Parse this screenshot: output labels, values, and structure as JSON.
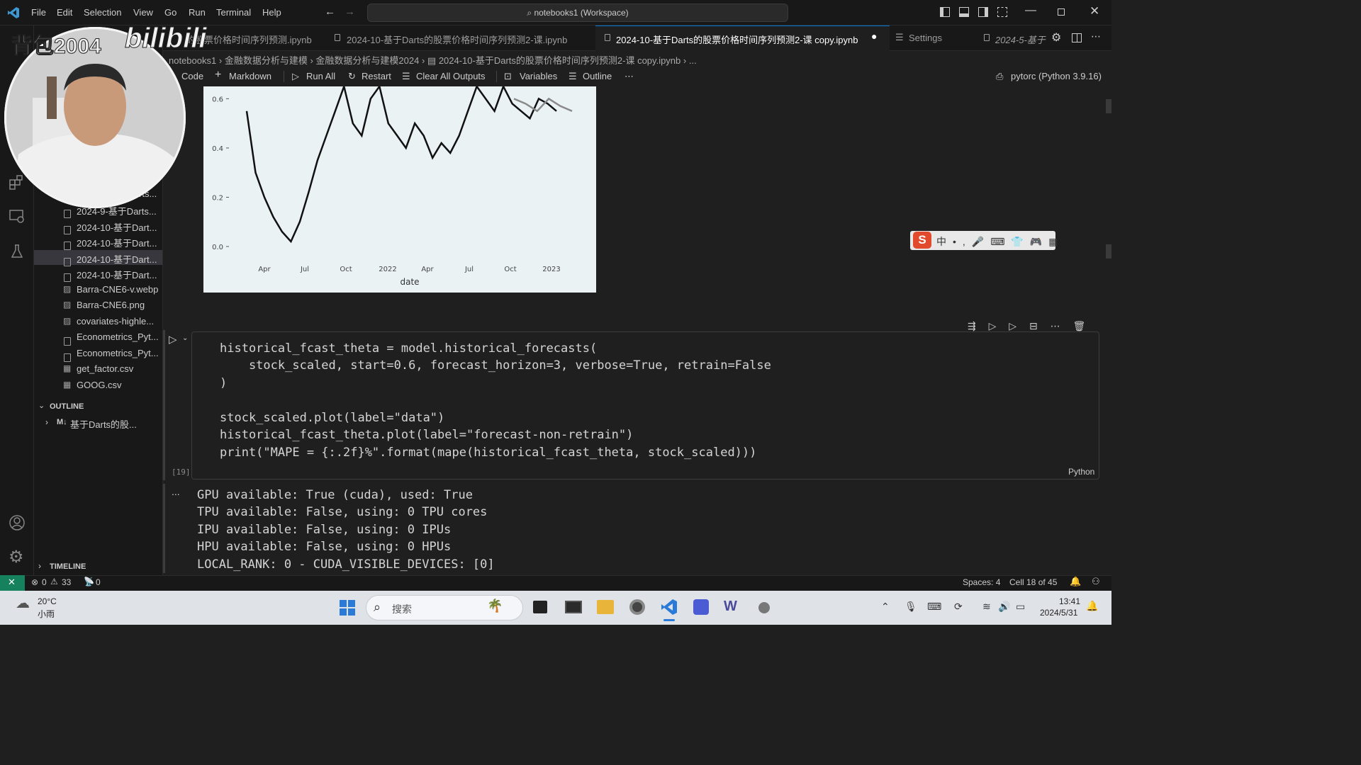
{
  "titlebar": {
    "menus": [
      "File",
      "Edit",
      "Selection",
      "View",
      "Go",
      "Run",
      "Terminal",
      "Help"
    ],
    "workspace": "notebooks1 (Workspace)"
  },
  "tabs": [
    {
      "label": "的股票价格时间序列预测.ipynb"
    },
    {
      "label": "2024-10-基于Darts的股票价格时间序列预测2-课.ipynb"
    },
    {
      "label": "2024-10-基于Darts的股票价格时间序列预测2-课 copy.ipynb"
    },
    {
      "label": "Settings"
    },
    {
      "label": "2024-5-基于"
    }
  ],
  "breadcrumb": [
    "notebooks1",
    "金融数据分析与建模",
    "金融数据分析与建模2024",
    "2024-10-基于Darts的股票价格时间序列预测2-课 copy.ipynb",
    "..."
  ],
  "toolbar": {
    "code": "Code",
    "markdown": "Markdown",
    "run_all": "Run All",
    "restart": "Restart",
    "clear": "Clear All Outputs",
    "variables": "Variables",
    "outline": "Outline",
    "kernel": "pytorc (Python 3.9.16)"
  },
  "sidebar": {
    "files": [
      "2024-9-基于Darts...",
      "2024-10-基于Dart...",
      "2024-10-基于Dart...",
      "2024-10-基于Dart...",
      "2024-10-基于Dart...",
      "Barra-CNE6-v.webp",
      "Barra-CNE6.png",
      "covariates-highle...",
      "Econometrics_Pyt...",
      "Econometrics_Pyt...",
      "get_factor.csv",
      "GOOG.csv"
    ],
    "partial_file": "rts...",
    "outline_title": "OUTLINE",
    "outline_item_tag": "M↓",
    "outline_item": "基于Darts的股...",
    "timeline_title": "TIMELINE"
  },
  "chart_data": {
    "type": "line",
    "xlabel": "date",
    "x_ticks": [
      "Apr",
      "Jul",
      "Oct",
      "2022",
      "Apr",
      "Jul",
      "Oct",
      "2023"
    ],
    "y_ticks": [
      "0.0",
      "0.2",
      "0.4",
      "0.6"
    ],
    "ylim": [
      0,
      0.65
    ],
    "grid": false,
    "series": [
      {
        "color": "#111111",
        "values": [
          0.55,
          0.3,
          0.2,
          0.12,
          0.06,
          0.02,
          0.1,
          0.22,
          0.35,
          0.45,
          0.55,
          0.65,
          0.5,
          0.45,
          0.6,
          0.65,
          0.5,
          0.45,
          0.4,
          0.5,
          0.45,
          0.36,
          0.42,
          0.38,
          0.45,
          0.55,
          0.65,
          0.6,
          0.55,
          0.65,
          0.58,
          0.55,
          0.52,
          0.6,
          0.58,
          0.55
        ]
      },
      {
        "color": "#8a8a8a",
        "values": [
          0.6,
          0.58,
          0.55,
          0.6,
          0.57,
          0.55
        ]
      }
    ]
  },
  "cell": {
    "execution_count": "[19]",
    "language": "Python",
    "code_lines": [
      "historical_fcast_theta = model.historical_forecasts(",
      "    stock_scaled, start=0.6, forecast_horizon=3, verbose=True, retrain=False",
      ")",
      "",
      "stock_scaled.plot(label=\"data\")",
      "historical_fcast_theta.plot(label=\"forecast-non-retrain\")",
      "print(\"MAPE = {:.2f}%\".format(mape(historical_fcast_theta, stock_scaled)))"
    ]
  },
  "output": [
    "GPU available: True (cuda), used: True",
    "TPU available: False, using: 0 TPU cores",
    "IPU available: False, using: 0 IPUs",
    "HPU available: False, using: 0 HPUs",
    "LOCAL_RANK: 0 - CUDA_VISIBLE_DEVICES: [0]"
  ],
  "output_more": "...",
  "statusbar": {
    "errors": "0",
    "warnings": "33",
    "ports": "0",
    "spaces": "Spaces: 4",
    "cell": "Cell 18 of 45"
  },
  "taskbar": {
    "temp": "20°C",
    "weather": "小雨",
    "search": "搜索",
    "time": "13:41",
    "date": "2024/5/31"
  },
  "watermark": {
    "text": "背包2004",
    "logo": "bilibili"
  }
}
